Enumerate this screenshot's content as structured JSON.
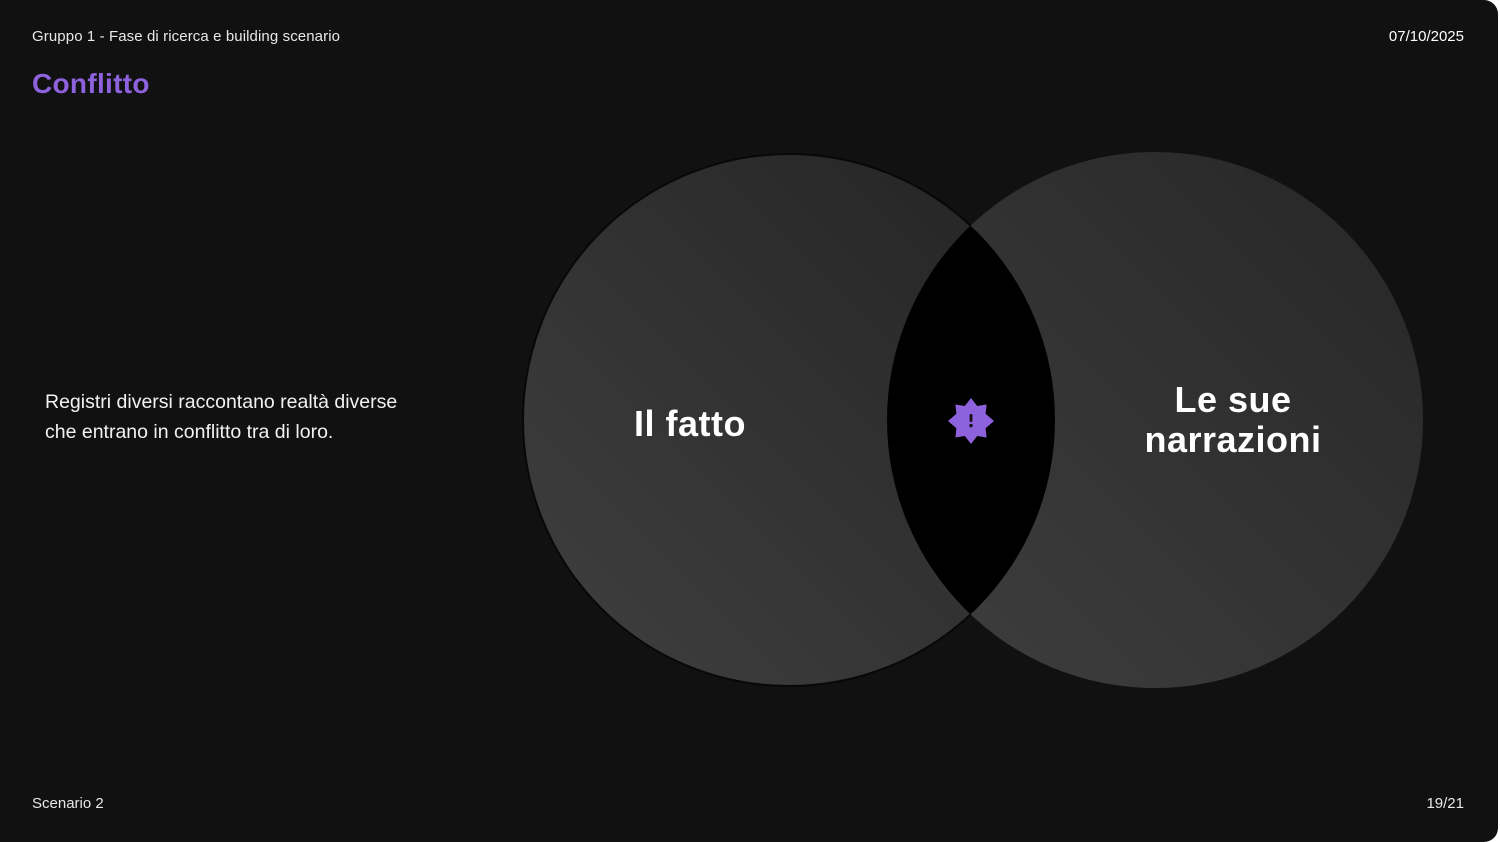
{
  "header": {
    "subtitle": "Gruppo 1 - Fase di ricerca e building scenario",
    "date": "07/10/2025"
  },
  "title": "Conflitto",
  "description": {
    "line1": "Registri diversi raccontano realtà diverse",
    "line2": "che entrano in conflitto tra di loro."
  },
  "diagram": {
    "left_circle_label": "Il fatto",
    "right_circle_label_line1": "Le sue",
    "right_circle_label_line2": "narrazioni",
    "intersection_icon": "alert-star-icon",
    "colors": {
      "circle_fill_light": "#3d3d3d",
      "circle_fill_dark": "#262626",
      "intersection": "#000000",
      "accent": "#8e62dc"
    }
  },
  "footer": {
    "scenario": "Scenario 2",
    "page": "19/21"
  }
}
